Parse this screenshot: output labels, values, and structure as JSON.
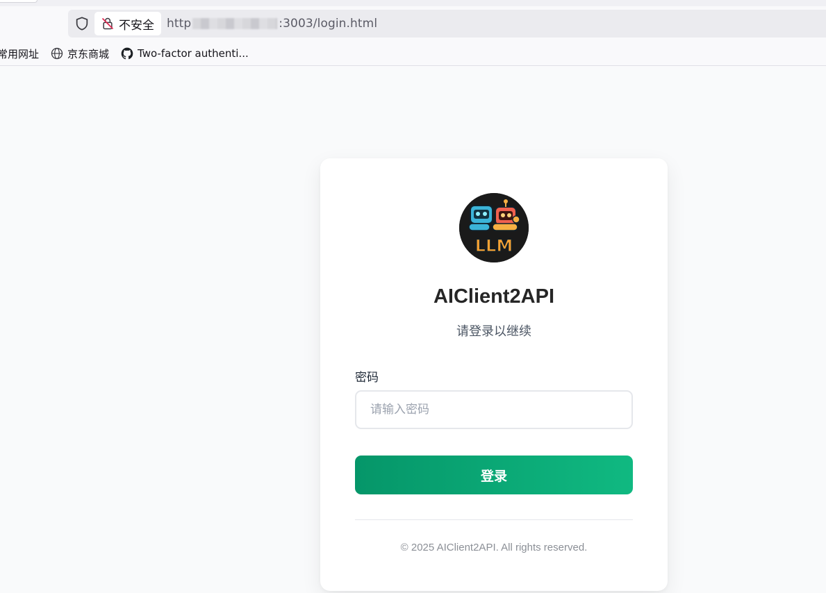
{
  "browser": {
    "security_label": "不安全",
    "url_prefix": "http",
    "url_suffix": ":3003/login.html",
    "bookmarks": [
      {
        "label": "常用网址"
      },
      {
        "label": "京东商城"
      },
      {
        "label": "Two-factor authenti..."
      }
    ]
  },
  "login": {
    "app_title": "AIClient2API",
    "subtitle": "请登录以继续",
    "password_label": "密码",
    "password_placeholder": "请输入密码",
    "password_value": "",
    "submit_label": "登录",
    "footer": "© 2025 AIClient2API. All rights reserved.",
    "logo_text": "LLM"
  },
  "colors": {
    "accent_start": "#059669",
    "accent_end": "#10b981",
    "page_bg": "#f9fafb",
    "logo_bg": "#1a1a1a"
  }
}
